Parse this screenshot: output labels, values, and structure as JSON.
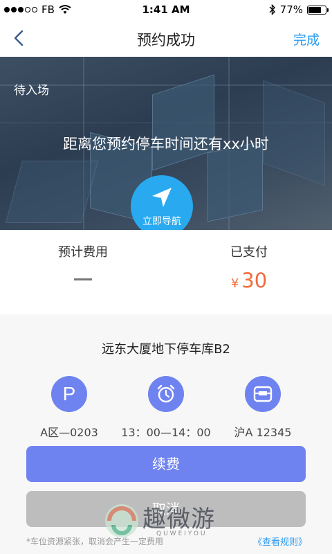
{
  "status_bar": {
    "carrier": "FB",
    "time": "1:41 AM",
    "battery": "77%",
    "battery_level": 0.77,
    "icons": [
      "signal-dots-icon",
      "wifi-icon",
      "bluetooth-icon",
      "battery-icon"
    ]
  },
  "nav": {
    "title": "预约成功",
    "done_label": "完成",
    "back_icon": "chevron-left-icon"
  },
  "hero": {
    "status": "待入场",
    "message": "距离您预约停车时间还有xx小时",
    "navigate_label": "立即导航",
    "navigate_icon": "navigation-arrow-icon"
  },
  "fees": {
    "estimated_label": "预计费用",
    "estimated_value": "—",
    "paid_label": "已支付",
    "paid_currency": "¥",
    "paid_amount": "30"
  },
  "parking": {
    "lot_name": "远东大厦地下停车库B2",
    "items": [
      {
        "icon": "parking-icon",
        "glyph": "P",
        "text": "A区—0203"
      },
      {
        "icon": "alarm-clock-icon",
        "text": "13：00—14：00"
      },
      {
        "icon": "car-plate-icon",
        "text": "沪A  12345"
      }
    ]
  },
  "actions": {
    "renew_label": "续费",
    "cancel_label": "取消"
  },
  "footer": {
    "note": "*车位资源紧张，取消会产生一定费用",
    "rules_link": "《查看规则》"
  },
  "watermark": {
    "text": "趣微游",
    "sub": "QUWEIYOU"
  },
  "colors": {
    "accent_blue": "#2b9cf2",
    "primary": "#6f83f0",
    "nav_circle": "#29a9f0",
    "paid_orange": "#f26b3a",
    "disabled_gray": "#bdbdbd"
  }
}
